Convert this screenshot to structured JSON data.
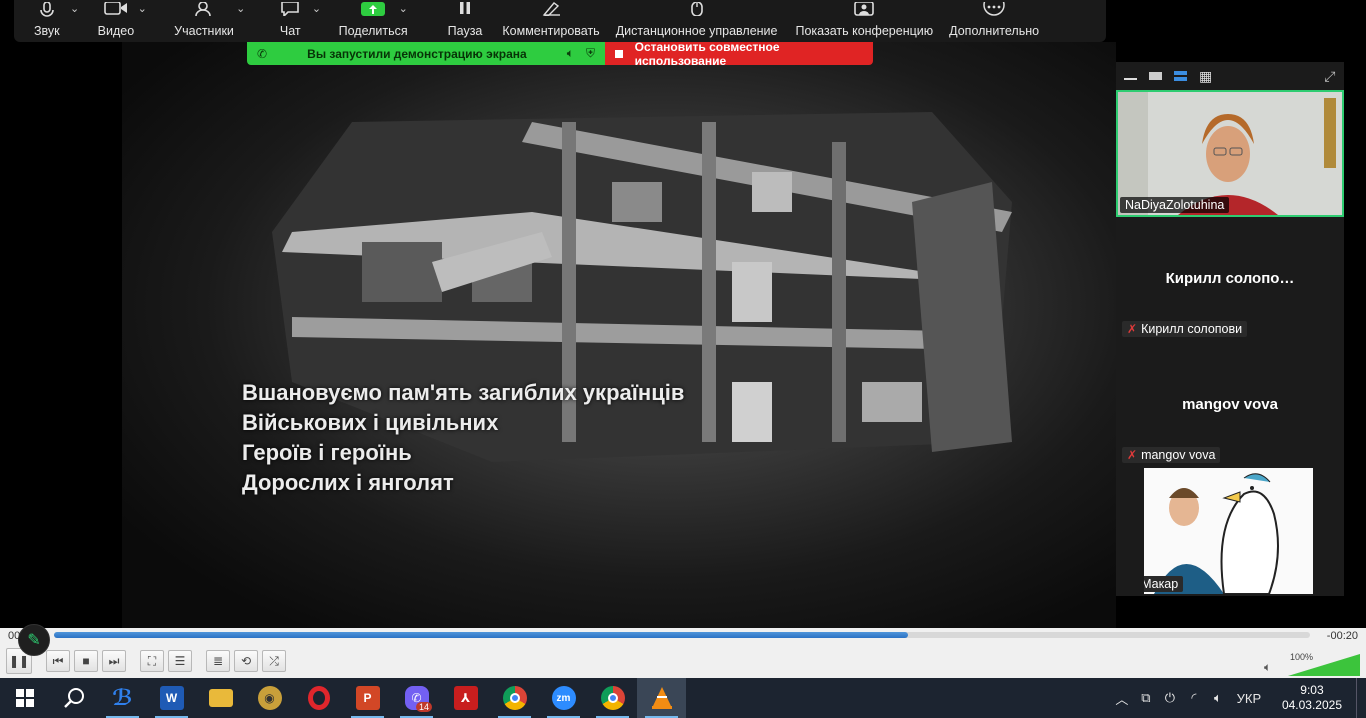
{
  "toolbar": {
    "items": [
      {
        "label": "Звук",
        "icon": "microphone-icon"
      },
      {
        "label": "Видео",
        "icon": "video-camera-icon"
      },
      {
        "label": "Участники",
        "icon": "participants-icon"
      },
      {
        "label": "Чат",
        "icon": "chat-icon"
      },
      {
        "label": "Поделиться",
        "icon": "share-screen-icon"
      },
      {
        "label": "Пауза",
        "icon": "pause-icon"
      },
      {
        "label": "Комментировать",
        "icon": "annotate-pencil-icon"
      },
      {
        "label": "Дистанционное управление",
        "icon": "mouse-icon"
      },
      {
        "label": "Показать конференцию",
        "icon": "show-meeting-icon"
      },
      {
        "label": "Дополнительно",
        "icon": "more-icon"
      }
    ]
  },
  "share_banner": {
    "status_text": "Вы запустили демонстрацию экрана",
    "stop_text": "Остановить совместное использование",
    "status_color": "#2ecc40",
    "stop_color": "#e02424"
  },
  "video": {
    "caption_lines": [
      "Вшановуємо пам'ять загиблих українців",
      "Військових і цивільних",
      "Героїв і героїнь",
      "Дорослих і янголят"
    ]
  },
  "participants": {
    "tile1_name": "NaDiyaZolotuhina",
    "tile2_big": "Кирилл  солопо…",
    "tile2_name": "Кирилл солопови",
    "tile3_big": "mangov vova",
    "tile3_name": "mangov vova",
    "tile4_name": "Макар"
  },
  "player": {
    "time_elapsed": "00",
    "time_remaining": "-00:20",
    "progress": 0.68,
    "volume_label": "100%",
    "volume": 1.0
  },
  "taskbar": {
    "apps": [
      "start-icon",
      "search-icon",
      "app-blue-icon",
      "word-icon",
      "file-explorer-icon",
      "eye-app-icon",
      "opera-icon",
      "powerpoint-icon",
      "viber-icon",
      "acrobat-icon",
      "chrome-icon",
      "zoom-icon",
      "chrome-profile-icon",
      "vlc-icon"
    ],
    "viber_badge": "14",
    "language": "УКР",
    "time": "9:03",
    "date": "04.03.2025"
  }
}
